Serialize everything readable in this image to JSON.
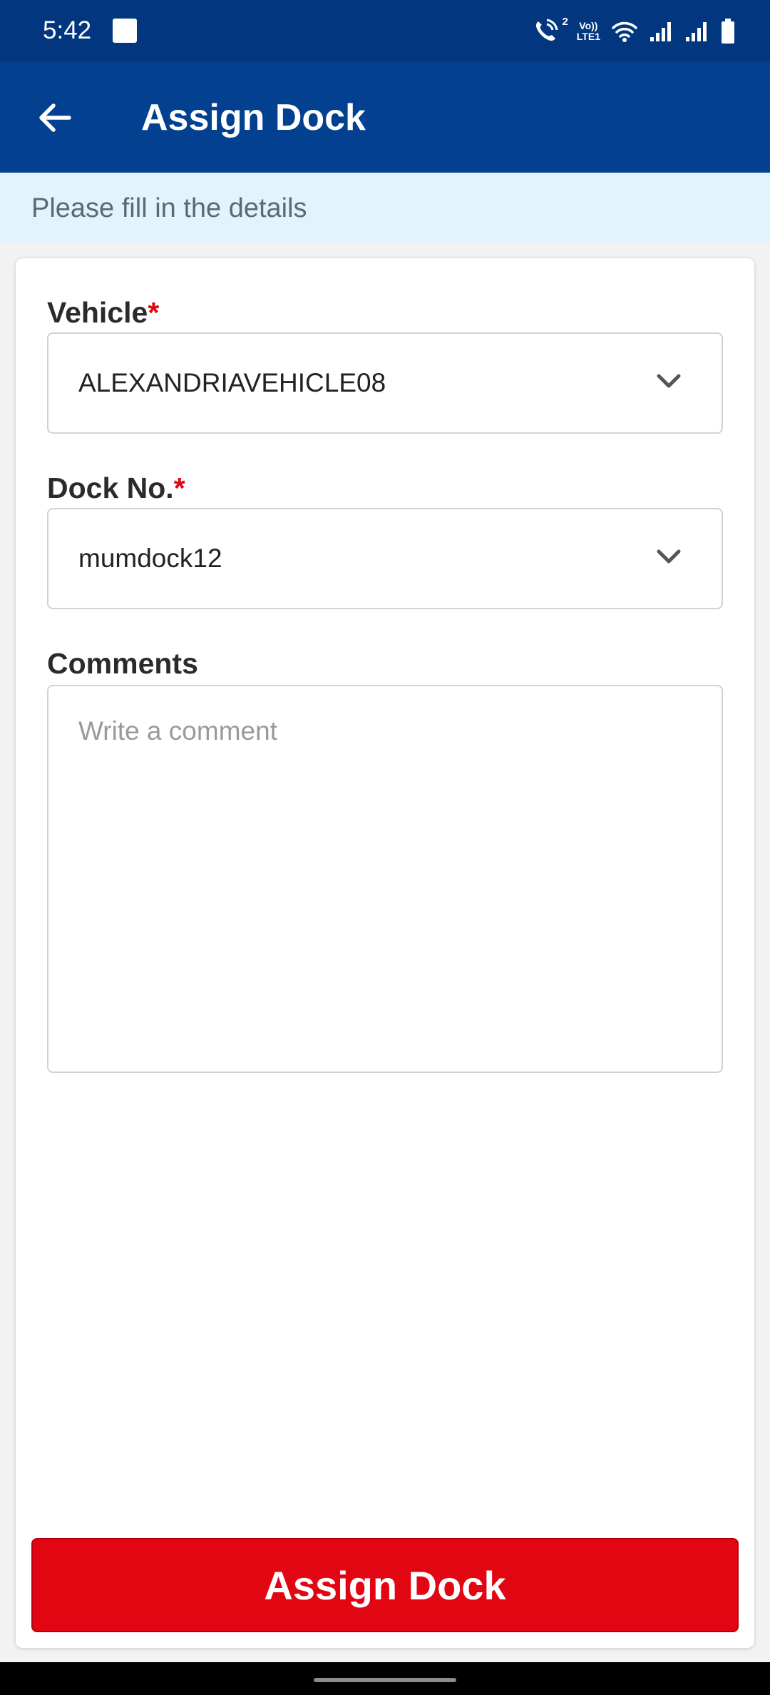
{
  "status_bar": {
    "time": "5:42",
    "volte_line1": "Vo))",
    "volte_line2": "LTE1",
    "call_badge": "2",
    "icons": [
      "app-notification-icon",
      "wifi-call-icon",
      "volte-icon",
      "wifi-icon",
      "signal-icon",
      "signal-icon",
      "battery-icon"
    ]
  },
  "app_bar": {
    "title": "Assign Dock",
    "back_icon": "arrow-left-icon"
  },
  "info": {
    "text": "Please fill in the details"
  },
  "form": {
    "vehicle": {
      "label": "Vehicle",
      "required_mark": "*",
      "value": "ALEXANDRIAVEHICLE08"
    },
    "dock": {
      "label": "Dock No.",
      "required_mark": "*",
      "value": "mumdock12"
    },
    "comments": {
      "label": "Comments",
      "placeholder": "Write a comment",
      "value": ""
    },
    "submit_label": "Assign Dock"
  },
  "colors": {
    "status_bar": "#02377f",
    "app_bar": "#03408f",
    "info_strip": "#e1f3fb",
    "accent_red": "#e20613",
    "required": "#e20612"
  }
}
